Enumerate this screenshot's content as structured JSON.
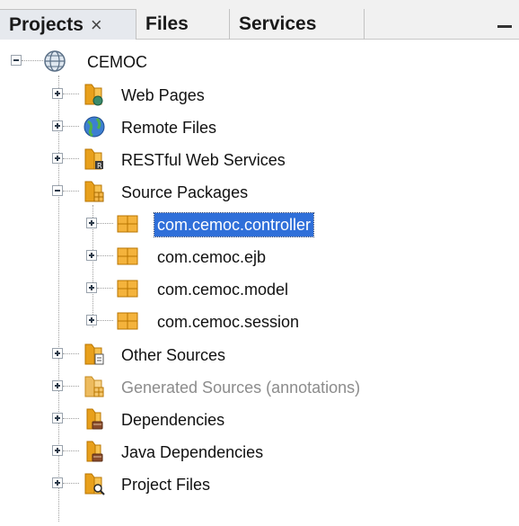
{
  "tabs": {
    "projects_label": "Projects",
    "projects_close": "×",
    "files_label": "Files",
    "services_label": "Services"
  },
  "tree": {
    "root": {
      "label": "CEMOC",
      "icon": "globe-project-icon"
    },
    "items": [
      {
        "label": "Web Pages",
        "icon": "web-pages-folder-icon"
      },
      {
        "label": "Remote Files",
        "icon": "remote-files-globe-icon"
      },
      {
        "label": "RESTful Web Services",
        "icon": "restful-folder-icon"
      },
      {
        "label": "Source Packages",
        "icon": "source-packages-folder-icon"
      },
      {
        "label": "com.cemoc.controller",
        "icon": "package-icon"
      },
      {
        "label": "com.cemoc.ejb",
        "icon": "package-icon"
      },
      {
        "label": "com.cemoc.model",
        "icon": "package-icon"
      },
      {
        "label": "com.cemoc.session",
        "icon": "package-icon"
      },
      {
        "label": "Other Sources",
        "icon": "other-sources-folder-icon"
      },
      {
        "label": "Generated Sources (annotations)",
        "icon": "generated-sources-folder-icon"
      },
      {
        "label": "Dependencies",
        "icon": "dependencies-folder-icon"
      },
      {
        "label": "Java Dependencies",
        "icon": "java-dependencies-folder-icon"
      },
      {
        "label": "Project Files",
        "icon": "project-files-folder-icon"
      }
    ]
  },
  "colors": {
    "selection": "#2f6fd9",
    "folder": "#e8a01c",
    "package": "#f0a830"
  }
}
